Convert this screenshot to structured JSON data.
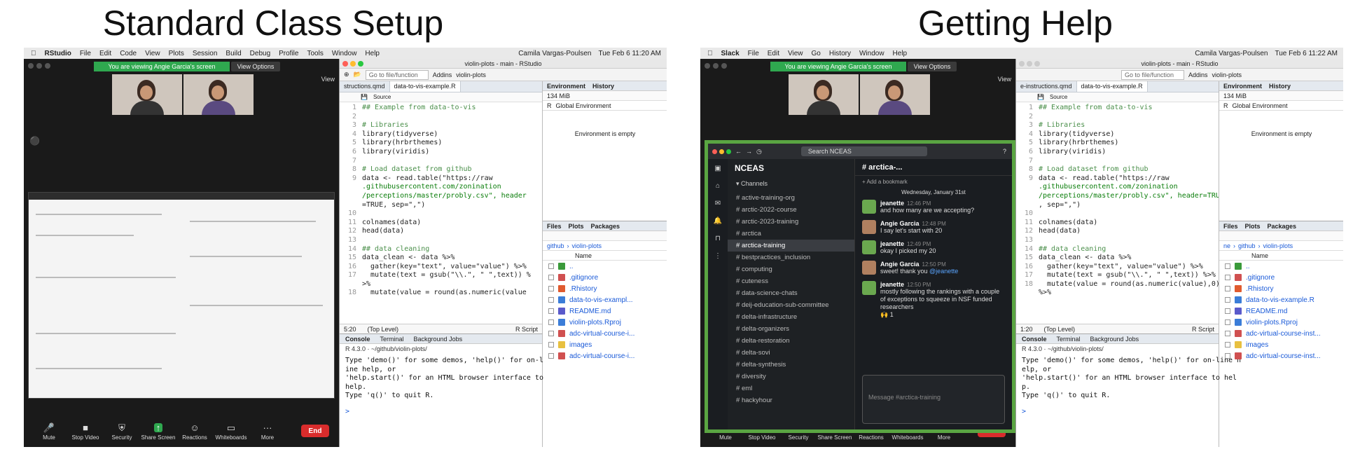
{
  "titles": {
    "left": "Standard Class Setup",
    "right": "Getting Help"
  },
  "left": {
    "menubar": {
      "app": "RStudio",
      "items": [
        "File",
        "Edit",
        "Code",
        "View",
        "Plots",
        "Session",
        "Build",
        "Debug",
        "Profile",
        "Tools",
        "Window",
        "Help"
      ],
      "user": "Camila Vargas-Poulsen",
      "clock": "Tue Feb 6  11:20 AM"
    },
    "rstudio_title": "violin-plots - main - RStudio",
    "clock_right": "Tue Feb 6  11:20 AM"
  },
  "right": {
    "menubar": {
      "app": "Slack",
      "items": [
        "File",
        "Edit",
        "View",
        "Go",
        "History",
        "Window",
        "Help"
      ],
      "user": "Camila Vargas-Poulsen",
      "clock": "Tue Feb 6  11:22 AM"
    },
    "rstudio_title": "violin-plots - main - RStudio"
  },
  "zoom": {
    "banner": "You are viewing Angie Garcia's screen",
    "view_options": "View Options",
    "view": "View",
    "toolbar": [
      "Mute",
      "Stop Video",
      "Security",
      "Share Screen",
      "Reactions",
      "Whiteboards",
      "More"
    ],
    "end": "End"
  },
  "rstudio": {
    "goto_file": "Go to file/function",
    "addins": "Addins",
    "project": "violin-plots",
    "tabs_left": [
      "structions.qmd",
      "data-to-vis-example.R"
    ],
    "tabs_right": [
      "e-instructions.qmd",
      "data-to-vis-example.R"
    ],
    "source_btn": "Source",
    "code": [
      {
        "n": "1",
        "t": "## Example from data-to-vis",
        "c": "cm"
      },
      {
        "n": "2",
        "t": "",
        "c": ""
      },
      {
        "n": "3",
        "t": "# Libraries",
        "c": "cm"
      },
      {
        "n": "4",
        "t": "library(tidyverse)",
        "c": ""
      },
      {
        "n": "5",
        "t": "library(hrbrthemes)",
        "c": ""
      },
      {
        "n": "6",
        "t": "library(viridis)",
        "c": ""
      },
      {
        "n": "7",
        "t": "",
        "c": ""
      },
      {
        "n": "8",
        "t": "# Load dataset from github",
        "c": "cm"
      },
      {
        "n": "9",
        "t": "data <- read.table(\"https://raw",
        "c": ""
      },
      {
        "n": "",
        "t": ".githubusercontent.com/zonination",
        "c": "str"
      },
      {
        "n": "",
        "t": "/perceptions/master/probly.csv\", header",
        "c": "str"
      },
      {
        "n": "",
        "t": "=TRUE, sep=\",\")",
        "c": ""
      },
      {
        "n": "10",
        "t": "",
        "c": ""
      },
      {
        "n": "11",
        "t": "colnames(data)",
        "c": ""
      },
      {
        "n": "12",
        "t": "head(data)",
        "c": ""
      },
      {
        "n": "13",
        "t": "",
        "c": ""
      },
      {
        "n": "14",
        "t": "## data cleaning",
        "c": "cm"
      },
      {
        "n": "15",
        "t": "data_clean <- data %>%",
        "c": ""
      },
      {
        "n": "16",
        "t": "  gather(key=\"text\", value=\"value\") %>%",
        "c": ""
      },
      {
        "n": "17",
        "t": "  mutate(text = gsub(\"\\\\.\", \" \",text)) %",
        "c": ""
      },
      {
        "n": "",
        "t": ">%",
        "c": ""
      },
      {
        "n": "18",
        "t": "  mutate(value = round(as.numeric(value",
        "c": ""
      }
    ],
    "code_right": [
      {
        "n": "1",
        "t": "## Example from data-to-vis",
        "c": "cm"
      },
      {
        "n": "2",
        "t": "",
        "c": ""
      },
      {
        "n": "3",
        "t": "# Libraries",
        "c": "cm"
      },
      {
        "n": "4",
        "t": "library(tidyverse)",
        "c": ""
      },
      {
        "n": "5",
        "t": "library(hrbrthemes)",
        "c": ""
      },
      {
        "n": "6",
        "t": "library(viridis)",
        "c": ""
      },
      {
        "n": "7",
        "t": "",
        "c": ""
      },
      {
        "n": "8",
        "t": "# Load dataset from github",
        "c": "cm"
      },
      {
        "n": "9",
        "t": "data <- read.table(\"https://raw",
        "c": ""
      },
      {
        "n": "",
        "t": ".githubusercontent.com/zonination",
        "c": "str"
      },
      {
        "n": "",
        "t": "/perceptions/master/probly.csv\", header=TRUE",
        "c": "str"
      },
      {
        "n": "",
        "t": ", sep=\",\")",
        "c": ""
      },
      {
        "n": "10",
        "t": "",
        "c": ""
      },
      {
        "n": "11",
        "t": "colnames(data)",
        "c": ""
      },
      {
        "n": "12",
        "t": "head(data)",
        "c": ""
      },
      {
        "n": "13",
        "t": "",
        "c": ""
      },
      {
        "n": "14",
        "t": "## data cleaning",
        "c": "cm"
      },
      {
        "n": "15",
        "t": "data_clean <- data %>%",
        "c": ""
      },
      {
        "n": "16",
        "t": "  gather(key=\"text\", value=\"value\") %>%",
        "c": ""
      },
      {
        "n": "17",
        "t": "  mutate(text = gsub(\"\\\\.\", \" \",text)) %>%",
        "c": ""
      },
      {
        "n": "18",
        "t": "  mutate(value = round(as.numeric(value),0))",
        "c": ""
      },
      {
        "n": "",
        "t": "%>%",
        "c": ""
      }
    ],
    "status_pos_left": "5:20",
    "status_pos_right": "1:20",
    "status_level": "(Top Level)",
    "status_type": "R Script",
    "console_tabs": [
      "Console",
      "Terminal",
      "Background Jobs"
    ],
    "console_path": "R 4.3.0 · ~/github/violin-plots/",
    "console_text_left": "Type 'demo()' for some demos, 'help()' for on-l\nine help, or\n'help.start()' for an HTML browser interface to\nhelp.\nType 'q()' to quit R.",
    "console_text_right": "Type 'demo()' for some demos, 'help()' for on-line h\nelp, or\n'help.start()' for an HTML browser interface to hel\np.\nType 'q()' to quit R.",
    "prompt": ">",
    "env_tabs": [
      "Environment",
      "History"
    ],
    "env_memory": "134 MiB",
    "env_lang": "R",
    "env_scope": "Global Environment",
    "env_empty": "Environment is empty",
    "files_tabs": [
      "Files",
      "Plots",
      "Packages"
    ],
    "files_path": [
      "github",
      "violin-plots"
    ],
    "files_path_right": [
      "ne",
      "github",
      "violin-plots"
    ],
    "files_header": "Name",
    "files": [
      {
        "name": "..",
        "color": "#3a9a3a"
      },
      {
        "name": ".gitignore",
        "color": "#d05050"
      },
      {
        "name": ".Rhistory",
        "color": "#e05b2f"
      },
      {
        "name": "data-to-vis-exampl...",
        "color": "#3b7dd8"
      },
      {
        "name": "README.md",
        "color": "#5a5acb"
      },
      {
        "name": "violin-plots.Rproj",
        "color": "#3b7dd8"
      },
      {
        "name": "adc-virtual-course-i...",
        "color": "#d05050"
      },
      {
        "name": "images",
        "color": "#e8c040"
      },
      {
        "name": "adc-virtual-course-i...",
        "color": "#d05050"
      }
    ],
    "files_right": [
      {
        "name": "..",
        "color": "#3a9a3a"
      },
      {
        "name": ".gitignore",
        "color": "#d05050"
      },
      {
        "name": ".Rhistory",
        "color": "#e05b2f"
      },
      {
        "name": "data-to-vis-example.R",
        "color": "#3b7dd8"
      },
      {
        "name": "README.md",
        "color": "#5a5acb"
      },
      {
        "name": "violin-plots.Rproj",
        "color": "#3b7dd8"
      },
      {
        "name": "adc-virtual-course-inst...",
        "color": "#d05050"
      },
      {
        "name": "images",
        "color": "#e8c040"
      },
      {
        "name": "adc-virtual-course-inst...",
        "color": "#d05050"
      }
    ]
  },
  "slack": {
    "search": "Search NCEAS",
    "workspace": "NCEAS",
    "channels_header": "Channels",
    "channels": [
      "active-training-org",
      "arctic-2022-course",
      "arctic-2023-training",
      "arctica",
      "arctica-training",
      "bestpractices_inclusion",
      "computing",
      "cuteness",
      "data-science-chats",
      "deij-education-sub-committee",
      "delta-infrastructure",
      "delta-organizers",
      "delta-restoration",
      "delta-sovi",
      "delta-synthesis",
      "diversity",
      "eml",
      "hackyhour"
    ],
    "active_channel": "arctica-training",
    "channel_title": "# arctica-...",
    "members": "7",
    "bookmark": "+ Add a bookmark",
    "date": "Wednesday, January 31st",
    "messages": [
      {
        "who": "jeanette",
        "time": "12:46 PM",
        "text": "and how many are we accepting?",
        "color": "#6aa84f"
      },
      {
        "who": "Angie Garcia",
        "time": "12:48 PM",
        "text": "I say let's start with 20",
        "color": "#b08060"
      },
      {
        "who": "jeanette",
        "time": "12:49 PM",
        "text": "okay I picked my 20",
        "color": "#6aa84f"
      },
      {
        "who": "Angie Garcia",
        "time": "12:50 PM",
        "text": "sweet! thank you",
        "mention": "@jeanette",
        "color": "#b08060"
      },
      {
        "who": "jeanette",
        "time": "12:50 PM",
        "text": "mostly following the rankings with a couple of exceptions to squeeze in NSF funded researchers",
        "color": "#6aa84f"
      }
    ],
    "reaction": "🙌 1",
    "compose_placeholder": "Message #arctica-training"
  }
}
